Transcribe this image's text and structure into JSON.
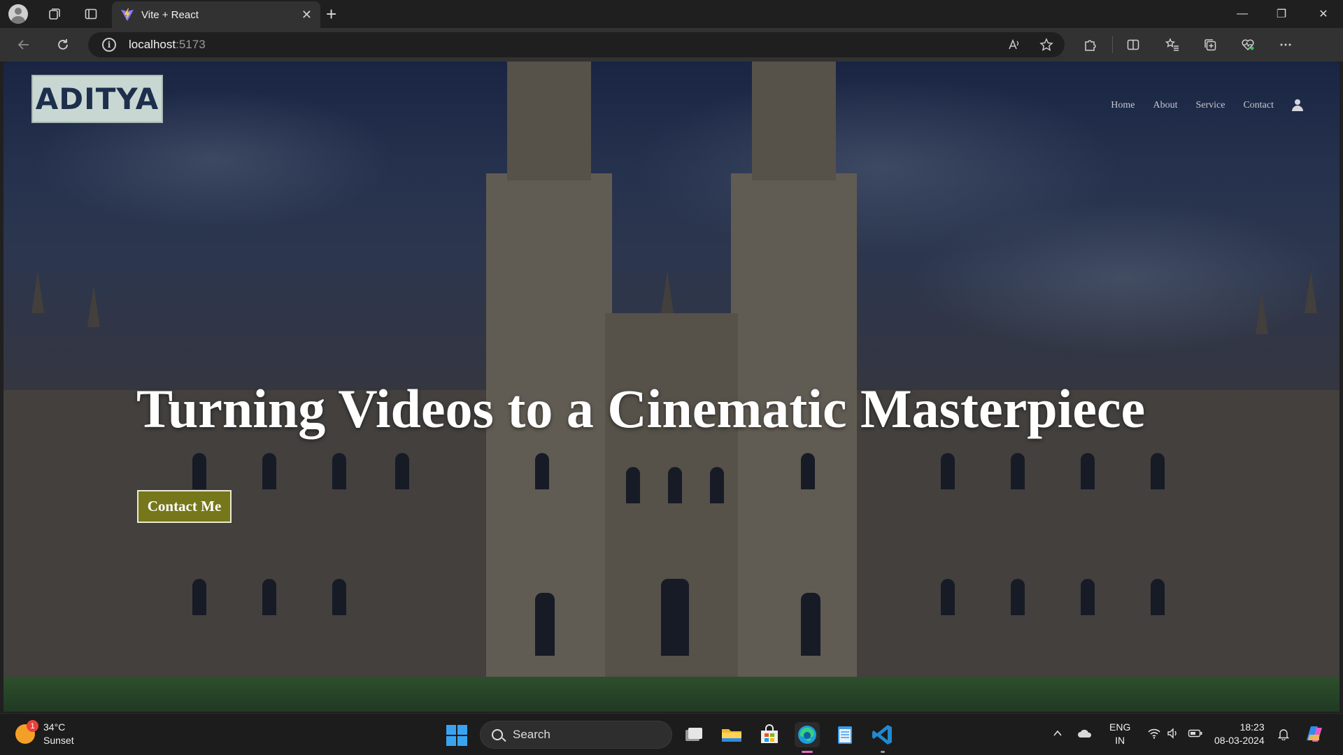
{
  "browser": {
    "tab_title": "Vite + React",
    "tab_close": "✕",
    "new_tab": "+",
    "url_host": "localhost",
    "url_port": ":5173",
    "window_controls": {
      "minimize": "—",
      "restore": "❐",
      "close": "✕"
    }
  },
  "site": {
    "logo_text": "ADITYA",
    "nav": [
      {
        "label": "Home"
      },
      {
        "label": "About"
      },
      {
        "label": "Service"
      },
      {
        "label": "Contact"
      }
    ],
    "hero_title": "Turning Videos to a Cinematic Masterpiece",
    "cta_label": "Contact Me",
    "colors": {
      "cta_bg": "#75771a",
      "cta_border": "#e9ecd1",
      "logo_bg": "#c9d7d3",
      "logo_text": "#1e2f4d"
    }
  },
  "taskbar": {
    "weather_badge": "1",
    "weather_temp": "34°C",
    "weather_desc": "Sunset",
    "search_label": "Search",
    "lang_primary": "ENG",
    "lang_region": "IN",
    "time": "18:23",
    "date": "08-03-2024"
  }
}
